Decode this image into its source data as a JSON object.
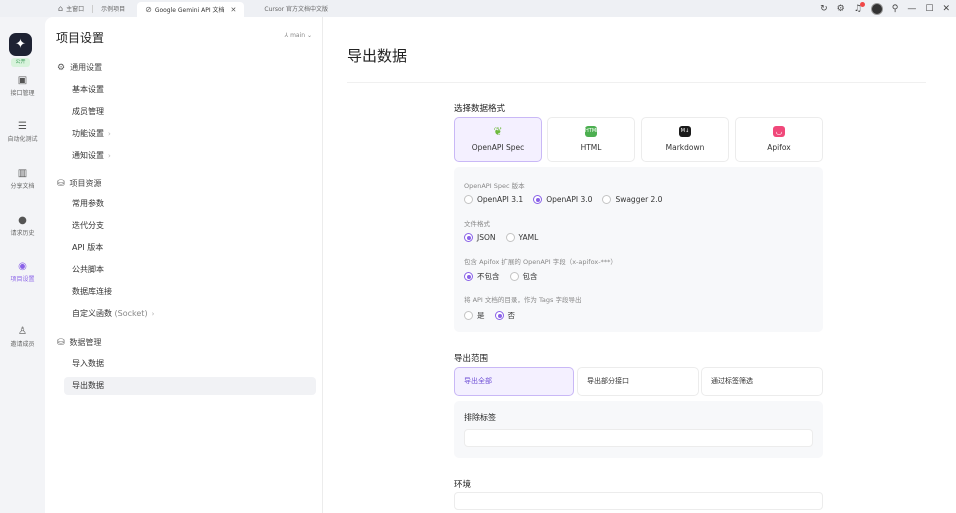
{
  "titlebar": {
    "tabs": [
      {
        "label": "主窗口",
        "icon": "home-icon"
      },
      {
        "label": "示例项目",
        "icon": ""
      },
      {
        "label": "Google Gemini API 文档",
        "icon": "link-icon",
        "active": true
      },
      {
        "label": "Cursor 官方文档中文版",
        "icon": ""
      }
    ]
  },
  "rail": {
    "badge": "公开",
    "items": [
      {
        "label": "接口管理",
        "icon": "api-icon"
      },
      {
        "label": "自动化测试",
        "icon": "test-icon"
      },
      {
        "label": "分享文档",
        "icon": "book-icon"
      },
      {
        "label": "请求历史",
        "icon": "history-icon"
      },
      {
        "label": "项目设置",
        "icon": "settings-icon",
        "active": true
      },
      {
        "label": "邀请成员",
        "icon": "invite-icon"
      }
    ]
  },
  "sidebar": {
    "title": "项目设置",
    "branch": "main",
    "groups": [
      {
        "label": "通用设置",
        "items": [
          "基本设置",
          "成员管理",
          "功能设置",
          "通知设置"
        ]
      },
      {
        "label": "项目资源",
        "items": [
          "常用参数",
          "迭代分支",
          "API 版本",
          "公共脚本",
          "数据库连接",
          "自定义函数",
          "(Socket)"
        ]
      },
      {
        "label": "数据管理",
        "items": [
          "导入数据",
          "导出数据"
        ]
      }
    ]
  },
  "main": {
    "title": "导出数据",
    "format_label": "选择数据格式",
    "formats": [
      {
        "label": "OpenAPI Spec",
        "color": "#6fba3f",
        "icon_text": "",
        "active": true
      },
      {
        "label": "HTML",
        "color": "#4caf50",
        "icon_text": "HTML"
      },
      {
        "label": "Markdown",
        "color": "#1a1a1a",
        "icon_text": "M↓"
      },
      {
        "label": "Apifox",
        "color": "#f0487a",
        "icon_text": ""
      }
    ],
    "options": {
      "q1": "OpenAPI Spec 版本",
      "q1_opts": [
        "OpenAPI 3.1",
        "OpenAPI 3.0",
        "Swagger 2.0"
      ],
      "q2": "文件格式",
      "q2_opts": [
        "JSON",
        "YAML"
      ],
      "q3": "包含 Apifox 扩展的 OpenAPI 字段（x-apifox-***）",
      "q3_opts": [
        "不包含",
        "包含"
      ],
      "q4": "将 API 文档的目录，作为 Tags 字段导出",
      "q4_opts": [
        "是",
        "否"
      ]
    },
    "scope_label": "导出范围",
    "scopes": [
      "导出全部",
      "导出部分接口",
      "通过标签筛选"
    ],
    "exclude_label": "排除标签",
    "env_label": "环境",
    "accent": "#8a62e8"
  }
}
